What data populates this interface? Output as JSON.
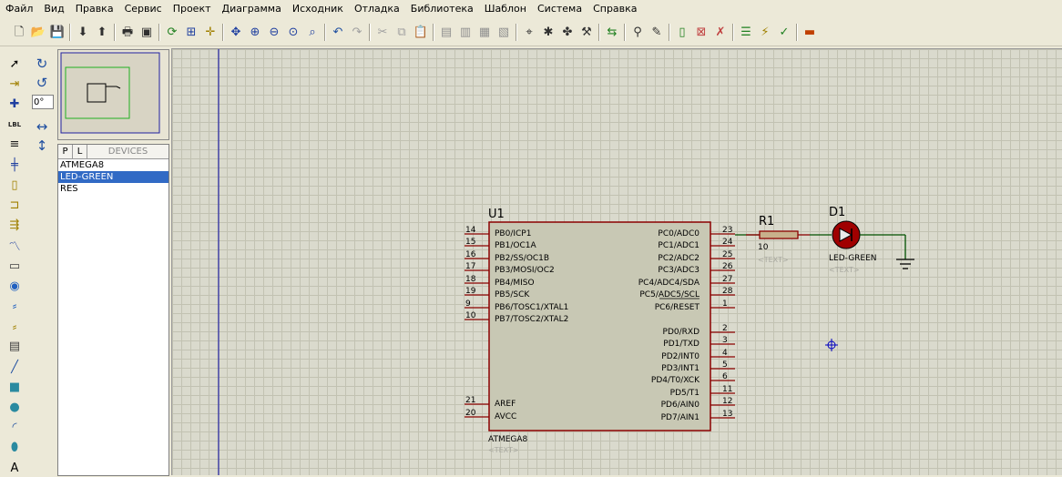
{
  "menu": [
    "Файл",
    "Вид",
    "Правка",
    "Сервис",
    "Проект",
    "Диаграмма",
    "Исходник",
    "Отладка",
    "Библиотека",
    "Шаблон",
    "Система",
    "Справка"
  ],
  "angle_value": "0°",
  "device_panel": {
    "tab_p": "P",
    "tab_l": "L",
    "header": "DEVICES",
    "items": [
      "ATMEGA8",
      "LED-GREEN",
      "RES"
    ],
    "selected_index": 1
  },
  "schematic": {
    "u1": {
      "ref": "U1",
      "part": "ATMEGA8",
      "text_placeholder": "<TEXT>",
      "left_pins": [
        {
          "num": "14",
          "name": "PB0/ICP1"
        },
        {
          "num": "15",
          "name": "PB1/OC1A"
        },
        {
          "num": "16",
          "name": "PB2/SS/OC1B"
        },
        {
          "num": "17",
          "name": "PB3/MOSI/OC2"
        },
        {
          "num": "18",
          "name": "PB4/MISO"
        },
        {
          "num": "19",
          "name": "PB5/SCK"
        },
        {
          "num": "9",
          "name": "PB6/TOSC1/XTAL1"
        },
        {
          "num": "10",
          "name": "PB7/TOSC2/XTAL2"
        }
      ],
      "left_power_pins": [
        {
          "num": "21",
          "name": "AREF"
        },
        {
          "num": "20",
          "name": "AVCC"
        }
      ],
      "right_pins_c": [
        {
          "num": "23",
          "name": "PC0/ADC0"
        },
        {
          "num": "24",
          "name": "PC1/ADC1"
        },
        {
          "num": "25",
          "name": "PC2/ADC2"
        },
        {
          "num": "26",
          "name": "PC3/ADC3"
        },
        {
          "num": "27",
          "name": "PC4/ADC4/SDA"
        },
        {
          "num": "28",
          "name": "PC5/ADC5/SCL"
        },
        {
          "num": "1",
          "name": "PC6/RESET"
        }
      ],
      "right_pins_d": [
        {
          "num": "2",
          "name": "PD0/RXD"
        },
        {
          "num": "3",
          "name": "PD1/TXD"
        },
        {
          "num": "4",
          "name": "PD2/INT0"
        },
        {
          "num": "5",
          "name": "PD3/INT1"
        },
        {
          "num": "6",
          "name": "PD4/T0/XCK"
        },
        {
          "num": "11",
          "name": "PD5/T1"
        },
        {
          "num": "12",
          "name": "PD6/AIN0"
        },
        {
          "num": "13",
          "name": "PD7/AIN1"
        }
      ]
    },
    "r1": {
      "ref": "R1",
      "value": "10",
      "text_placeholder": "<TEXT>"
    },
    "d1": {
      "ref": "D1",
      "part": "LED-GREEN",
      "text_placeholder": "<TEXT>"
    }
  },
  "colors": {
    "canvas_bg": "#dadacd",
    "grid": "#c2c2b2",
    "component_fill": "#c8c8b4",
    "component_outline": "#8b0000",
    "wire": "#005000",
    "led": "#a00000",
    "placeholder": "#a8a8a0",
    "blue_line": "#0000a0"
  },
  "toolbar_icons": [
    "new-file",
    "open-file",
    "save-file",
    "import",
    "export",
    "print",
    "print-area",
    "refresh",
    "grid",
    "origin",
    "pan",
    "zoom-in",
    "zoom-out",
    "zoom-all",
    "zoom-area",
    "undo",
    "redo",
    "cut",
    "copy",
    "paste",
    "block-copy",
    "block-move",
    "block-rotate",
    "block-delete",
    "pick-device",
    "make-device",
    "packaging",
    "decompose",
    "wire-autorouter",
    "search",
    "property-assign",
    "new-sheet",
    "remove-sheet",
    "goto-sheet",
    "bill-of-materials",
    "netlist",
    "electrical-check",
    "ares"
  ],
  "left_tool_icons": [
    "selection",
    "component",
    "junction",
    "wire-label",
    "text-script",
    "bus",
    "subcircuit",
    "terminal",
    "device-pin",
    "graph",
    "tape-recorder",
    "generator",
    "voltage-probe",
    "current-probe",
    "virtual-instrument",
    "line",
    "box",
    "circle",
    "arc",
    "path",
    "text"
  ],
  "side_tool_icons": [
    "rotate-clockwise",
    "rotate-anticlockwise",
    "mirror-horizontal",
    "mirror-vertical"
  ]
}
